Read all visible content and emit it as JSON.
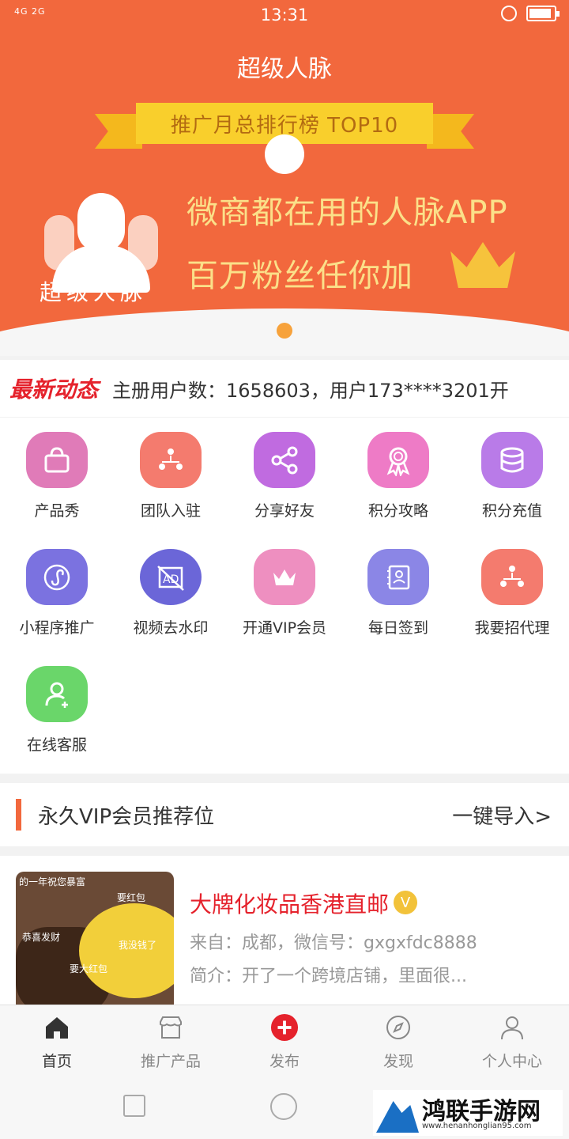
{
  "status_bar": {
    "signal": "4G 2G",
    "time": "13:31"
  },
  "banner": {
    "app_title": "超级人脉",
    "ribbon": "推广月总排行榜  TOP10",
    "headline1": "微商都在用的人脉APP",
    "headline2": "百万粉丝任你加",
    "brand": "超级人脉"
  },
  "ticker": {
    "tag": "最新动态",
    "text": "主册用户数：1658603，用户173****3201开"
  },
  "grid": {
    "items": [
      {
        "label": "产品秀",
        "icon": "shopping-bag-icon",
        "color": "#e07bb8"
      },
      {
        "label": "团队入驻",
        "icon": "team-icon",
        "color": "#f47b6e"
      },
      {
        "label": "分享好友",
        "icon": "share-icon",
        "color": "#c06be0"
      },
      {
        "label": "积分攻略",
        "icon": "award-ribbon-icon",
        "color": "#ee7bc6"
      },
      {
        "label": "积分充值",
        "icon": "coins-stack-icon",
        "color": "#b97be8"
      },
      {
        "label": "小程序推广",
        "icon": "mini-program-icon",
        "color": "#7b72e0"
      },
      {
        "label": "视频去水印",
        "icon": "no-watermark-icon",
        "color": "#6b66d8"
      },
      {
        "label": "开通VIP会员",
        "icon": "crown-icon",
        "color": "#ee8fc0"
      },
      {
        "label": "每日签到",
        "icon": "checkin-book-icon",
        "color": "#8b86e6"
      },
      {
        "label": "我要招代理",
        "icon": "agent-network-icon",
        "color": "#f47b6e"
      },
      {
        "label": "在线客服",
        "icon": "customer-service-icon",
        "color": "#6ad66a"
      }
    ]
  },
  "vip_section": {
    "title": "永久VIP会员推荐位",
    "import_label": "一键导入>"
  },
  "listing": {
    "shop_name": "大牌化妆品香港直邮",
    "verified_badge": "V",
    "from": "来自：成都，微信号：gxgxfdc8888",
    "intro": "简介：开了一个跨境店铺，里面很...",
    "thumb_captions": [
      "的一年祝您暴富",
      "要红包",
      "恭喜发财",
      "我没钱了",
      "要大红包"
    ]
  },
  "tabbar": {
    "items": [
      {
        "label": "首页",
        "icon": "home-icon",
        "active": true
      },
      {
        "label": "推广产品",
        "icon": "store-icon",
        "active": false
      },
      {
        "label": "发布",
        "icon": "plus-circle-icon",
        "active": false
      },
      {
        "label": "发现",
        "icon": "compass-icon",
        "active": false
      },
      {
        "label": "个人中心",
        "icon": "user-icon",
        "active": false
      }
    ]
  },
  "watermark": {
    "name": "鸿联手游网",
    "url": "www.henanhonglian95.com"
  },
  "colors": {
    "brand": "#f2683d",
    "accent_red": "#e5222c",
    "banner_text": "#fbe089"
  }
}
